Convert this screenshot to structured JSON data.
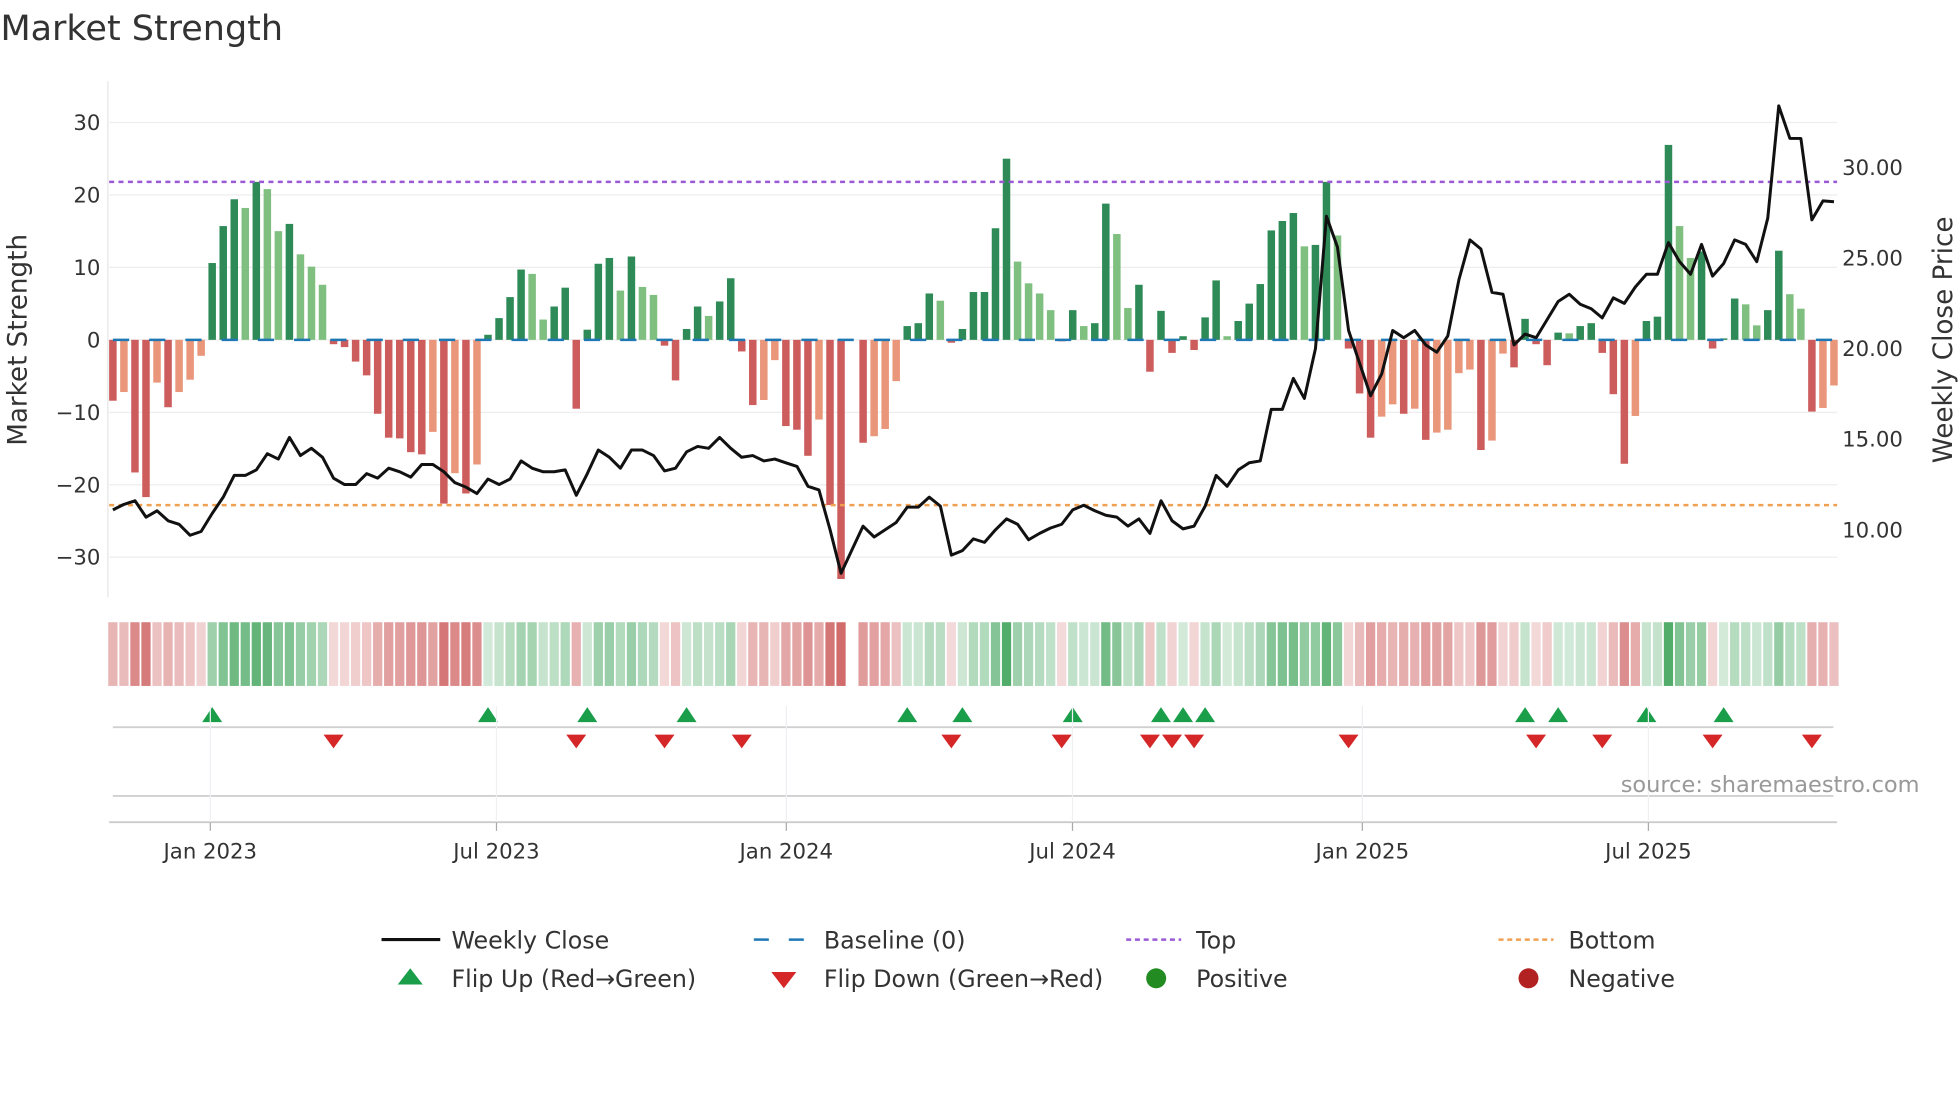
{
  "title": "Market Strength",
  "source": "source: sharemaestro.com",
  "colors": {
    "strong_green": "#2e8b57",
    "weak_green": "#7fbf7f",
    "strong_red": "#cd5c5c",
    "weak_red": "#e9967a",
    "price_line": "#111111",
    "baseline": "#1f77b4",
    "top": "#9b59d6",
    "bottom": "#f0a050",
    "flip_up": "#1a9e4a",
    "flip_down": "#d62728",
    "positive": "#228b22",
    "negative": "#b22222"
  },
  "chart_data": {
    "type": "bar",
    "title": "Market Strength",
    "ylabel": "Market Strength",
    "y2label": "Weekly Close Price",
    "ylim": [
      -35.7,
      35.7
    ],
    "y2lim": [
      5.9,
      34.3
    ],
    "yticks": [
      30,
      20,
      10,
      0,
      -10,
      -20,
      -30
    ],
    "yticklabels": [
      "30",
      "20",
      "10",
      "0",
      "−10",
      "−20",
      "−30"
    ],
    "y2ticks": [
      30,
      25,
      20,
      15,
      10
    ],
    "y2ticklabels": [
      "30.00",
      "25.00",
      "20.00",
      "15.00",
      "10.00"
    ],
    "xticks": [
      {
        "label": "Jan 2023",
        "week": 8.83
      },
      {
        "label": "Jul 2023",
        "week": 34.77
      },
      {
        "label": "Jan 2024",
        "week": 61.04
      },
      {
        "label": "Jul 2024",
        "week": 86.98
      },
      {
        "label": "Jan 2025",
        "week": 113.25
      },
      {
        "label": "Jul 2025",
        "week": 139.18
      }
    ],
    "top_level": 21.8,
    "bottom_level": -22.8,
    "baseline": 0,
    "strength": [
      -8.4,
      -7.2,
      -18.3,
      -21.7,
      -5.9,
      -9.3,
      -7.2,
      -5.5,
      -2.2,
      10.6,
      15.7,
      19.4,
      18.2,
      21.8,
      20.8,
      15.0,
      16.0,
      11.8,
      10.1,
      7.6,
      -0.6,
      -1.0,
      -3.0,
      -4.9,
      -10.2,
      -13.5,
      -13.6,
      -15.5,
      -15.8,
      -12.7,
      -22.6,
      -18.4,
      -21.2,
      -17.2,
      0.7,
      3.0,
      5.9,
      9.7,
      9.1,
      2.8,
      4.6,
      7.2,
      -9.5,
      1.4,
      10.5,
      11.3,
      6.8,
      11.5,
      7.3,
      6.2,
      -0.8,
      -5.6,
      1.5,
      4.6,
      3.3,
      5.3,
      8.5,
      -1.6,
      -9.0,
      -8.3,
      -2.8,
      -11.9,
      -12.4,
      -16.0,
      -11.0,
      -22.8,
      -33.0,
      0,
      -14.2,
      -13.3,
      -12.3,
      -5.7,
      1.9,
      2.3,
      6.4,
      5.4,
      -0.4,
      1.5,
      6.6,
      6.6,
      15.4,
      25.0,
      10.8,
      7.8,
      6.4,
      4.1,
      -0.2,
      4.1,
      1.9,
      2.3,
      18.8,
      14.6,
      4.4,
      7.6,
      -4.4,
      4.0,
      -1.8,
      0.5,
      -1.4,
      3.1,
      8.2,
      0.5,
      2.6,
      5.0,
      7.7,
      15.1,
      16.4,
      17.5,
      12.9,
      13.1,
      21.8,
      14.4,
      -1.2,
      -7.4,
      -13.5,
      -10.6,
      -8.9,
      -10.2,
      -9.5,
      -13.8,
      -12.8,
      -12.4,
      -4.6,
      -4.1,
      -15.2,
      -13.9,
      -1.9,
      -3.8,
      2.9,
      -0.6,
      -3.5,
      1.0,
      0.9,
      1.9,
      2.3,
      -1.8,
      -7.5,
      -17.1,
      -10.5,
      2.6,
      3.2,
      26.9,
      15.7,
      11.3,
      12.2,
      -1.2,
      0.2,
      5.7,
      4.9,
      2.0,
      4.1,
      12.3,
      6.3,
      4.3,
      -9.9,
      -9.4,
      -6.3
    ],
    "close": [
      11.1,
      11.4,
      11.6,
      10.7,
      11.05,
      10.5,
      10.3,
      9.7,
      9.9,
      10.9,
      11.8,
      13.0,
      13.0,
      13.3,
      14.2,
      13.9,
      15.1,
      14.1,
      14.5,
      14.0,
      12.85,
      12.5,
      12.5,
      13.1,
      12.85,
      13.4,
      13.2,
      12.9,
      13.6,
      13.6,
      13.2,
      12.6,
      12.35,
      12.0,
      12.8,
      12.5,
      12.8,
      13.8,
      13.4,
      13.2,
      13.2,
      13.3,
      11.9,
      13.1,
      14.4,
      14.0,
      13.4,
      14.4,
      14.4,
      14.1,
      13.25,
      13.4,
      14.3,
      14.6,
      14.5,
      15.1,
      14.5,
      14.0,
      14.1,
      13.8,
      13.9,
      13.7,
      13.5,
      12.4,
      12.2,
      10.0,
      7.6,
      8.9,
      10.2,
      9.6,
      10.0,
      10.4,
      11.25,
      11.25,
      11.8,
      11.3,
      8.6,
      8.85,
      9.5,
      9.3,
      10.0,
      10.6,
      10.3,
      9.45,
      9.8,
      10.1,
      10.3,
      11.1,
      11.35,
      11.05,
      10.8,
      10.7,
      10.2,
      10.6,
      9.8,
      11.6,
      10.5,
      10.05,
      10.2,
      11.3,
      13.0,
      12.4,
      13.3,
      13.7,
      13.8,
      16.65,
      16.65,
      18.35,
      17.25,
      20.0,
      27.3,
      25.6,
      21.0,
      19.2,
      17.4,
      18.6,
      21.0,
      20.6,
      21.0,
      20.2,
      19.8,
      20.7,
      23.8,
      26.0,
      25.5,
      23.1,
      23.0,
      20.2,
      20.8,
      20.6,
      21.6,
      22.6,
      23.0,
      22.45,
      22.2,
      21.7,
      22.8,
      22.5,
      23.4,
      24.1,
      24.1,
      25.85,
      24.8,
      24.1,
      25.75,
      24.0,
      24.7,
      26.0,
      25.75,
      24.8,
      27.2,
      33.4,
      31.6,
      31.6,
      27.1,
      28.15,
      28.1
    ],
    "legend": {
      "weekly_close": "Weekly Close",
      "baseline": "Baseline (0)",
      "top": "Top",
      "bottom": "Bottom",
      "flip_up": "Flip Up (Red→Green)",
      "flip_down": "Flip Down (Green→Red)",
      "positive": "Positive",
      "negative": "Negative"
    }
  }
}
